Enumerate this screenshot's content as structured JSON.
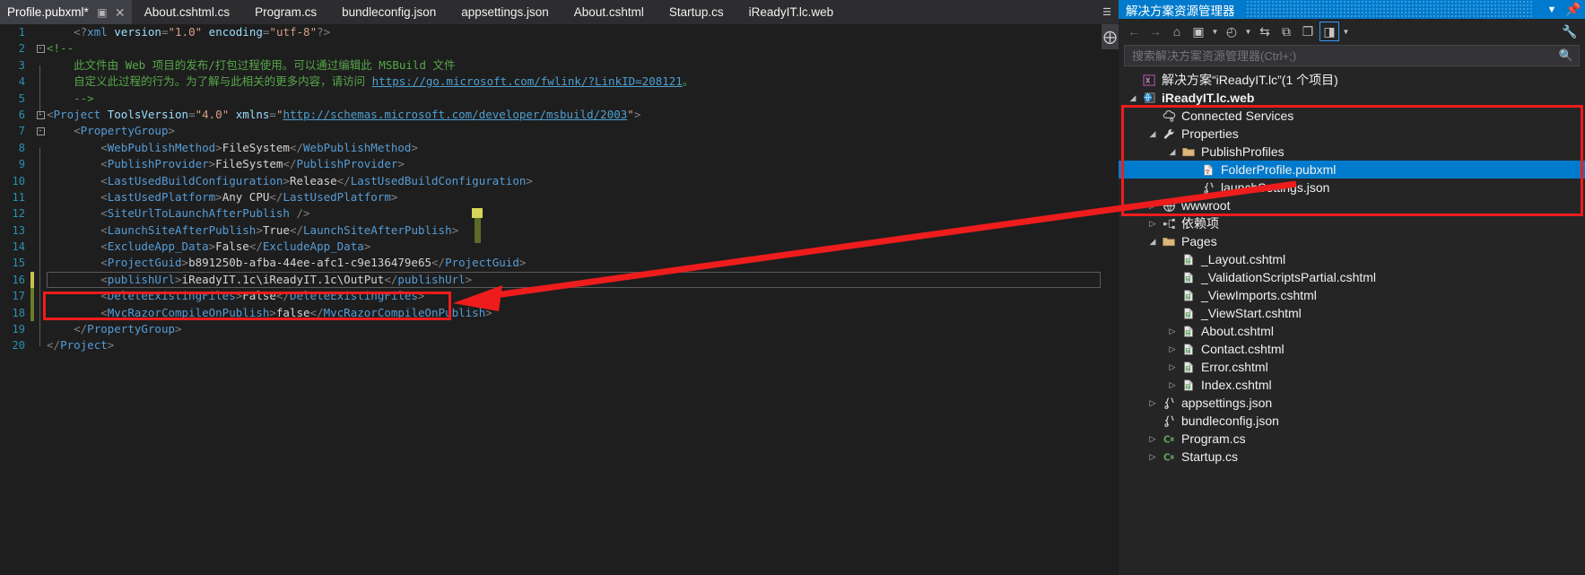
{
  "window": {
    "theme_background": "#1e1e1e",
    "accent": "#007acc",
    "highlight_rect_color": "#ee1c1c"
  },
  "tabs": {
    "items": [
      {
        "label": "Profile.pubxml*",
        "active": true,
        "pin_icon": "pin-icon",
        "close_icon": "close-icon"
      },
      {
        "label": "About.cshtml.cs",
        "active": false
      },
      {
        "label": "Program.cs",
        "active": false
      },
      {
        "label": "bundleconfig.json",
        "active": false
      },
      {
        "label": "appsettings.json",
        "active": false
      },
      {
        "label": "About.cshtml",
        "active": false
      },
      {
        "label": "Startup.cs",
        "active": false
      },
      {
        "label": "iReadyIT.lc.web",
        "active": false
      }
    ],
    "overflow_icon": "tab-overflow-icon"
  },
  "editor": {
    "language": "xml",
    "current_line": 16,
    "lines": [
      {
        "n": 1,
        "indent": 1,
        "tokens": [
          {
            "t": "punct",
            "s": "<?"
          },
          {
            "t": "tag",
            "s": "xml"
          },
          {
            "t": "plain",
            "s": " "
          },
          {
            "t": "attr",
            "s": "version"
          },
          {
            "t": "punct",
            "s": "="
          },
          {
            "t": "str",
            "s": "\"1.0\""
          },
          {
            "t": "plain",
            "s": " "
          },
          {
            "t": "attr",
            "s": "encoding"
          },
          {
            "t": "punct",
            "s": "="
          },
          {
            "t": "str",
            "s": "\"utf-8\""
          },
          {
            "t": "punct",
            "s": "?>"
          }
        ]
      },
      {
        "n": 2,
        "indent": 0,
        "fold": "collapse",
        "tokens": [
          {
            "t": "com",
            "s": "<!--"
          }
        ]
      },
      {
        "n": 3,
        "indent": 1,
        "bar": true,
        "tokens": [
          {
            "t": "com",
            "s": "此文件由 Web 项目的发布/打包过程使用。可以通过编辑此 MSBuild 文件"
          }
        ]
      },
      {
        "n": 4,
        "indent": 1,
        "bar": true,
        "tokens": [
          {
            "t": "com",
            "s": "自定义此过程的行为。为了解与此相关的更多内容，请访问 "
          },
          {
            "t": "link",
            "s": "https://go.microsoft.com/fwlink/?LinkID=208121"
          },
          {
            "t": "com",
            "s": "。"
          }
        ]
      },
      {
        "n": 5,
        "indent": 1,
        "bar": true,
        "tokens": [
          {
            "t": "com",
            "s": "-->"
          }
        ]
      },
      {
        "n": 6,
        "indent": 0,
        "fold": "collapse",
        "tokens": [
          {
            "t": "punct",
            "s": "<"
          },
          {
            "t": "tag",
            "s": "Project"
          },
          {
            "t": "plain",
            "s": " "
          },
          {
            "t": "attr",
            "s": "ToolsVersion"
          },
          {
            "t": "punct",
            "s": "="
          },
          {
            "t": "str",
            "s": "\"4.0\""
          },
          {
            "t": "plain",
            "s": " "
          },
          {
            "t": "attr",
            "s": "xmlns"
          },
          {
            "t": "punct",
            "s": "="
          },
          {
            "t": "str",
            "s": "\""
          },
          {
            "t": "link",
            "s": "http://schemas.microsoft.com/developer/msbuild/2003"
          },
          {
            "t": "str",
            "s": "\""
          },
          {
            "t": "punct",
            "s": ">"
          }
        ]
      },
      {
        "n": 7,
        "indent": 1,
        "fold": "collapse",
        "bar": true,
        "tokens": [
          {
            "t": "punct",
            "s": "<"
          },
          {
            "t": "tag",
            "s": "PropertyGroup"
          },
          {
            "t": "punct",
            "s": ">"
          }
        ]
      },
      {
        "n": 8,
        "indent": 2,
        "bar": true,
        "tokens": [
          {
            "t": "punct",
            "s": "<"
          },
          {
            "t": "tag",
            "s": "WebPublishMethod"
          },
          {
            "t": "punct",
            "s": ">"
          },
          {
            "t": "val",
            "s": "FileSystem"
          },
          {
            "t": "punct",
            "s": "</"
          },
          {
            "t": "tag",
            "s": "WebPublishMethod"
          },
          {
            "t": "punct",
            "s": ">"
          }
        ]
      },
      {
        "n": 9,
        "indent": 2,
        "bar": true,
        "tokens": [
          {
            "t": "punct",
            "s": "<"
          },
          {
            "t": "tag",
            "s": "PublishProvider"
          },
          {
            "t": "punct",
            "s": ">"
          },
          {
            "t": "val",
            "s": "FileSystem"
          },
          {
            "t": "punct",
            "s": "</"
          },
          {
            "t": "tag",
            "s": "PublishProvider"
          },
          {
            "t": "punct",
            "s": ">"
          }
        ]
      },
      {
        "n": 10,
        "indent": 2,
        "bar": true,
        "tokens": [
          {
            "t": "punct",
            "s": "<"
          },
          {
            "t": "tag",
            "s": "LastUsedBuildConfiguration"
          },
          {
            "t": "punct",
            "s": ">"
          },
          {
            "t": "val",
            "s": "Release"
          },
          {
            "t": "punct",
            "s": "</"
          },
          {
            "t": "tag",
            "s": "LastUsedBuildConfiguration"
          },
          {
            "t": "punct",
            "s": ">"
          }
        ]
      },
      {
        "n": 11,
        "indent": 2,
        "bar": true,
        "tokens": [
          {
            "t": "punct",
            "s": "<"
          },
          {
            "t": "tag",
            "s": "LastUsedPlatform"
          },
          {
            "t": "punct",
            "s": ">"
          },
          {
            "t": "val",
            "s": "Any CPU"
          },
          {
            "t": "punct",
            "s": "</"
          },
          {
            "t": "tag",
            "s": "LastUsedPlatform"
          },
          {
            "t": "punct",
            "s": ">"
          }
        ]
      },
      {
        "n": 12,
        "indent": 2,
        "bar": true,
        "tokens": [
          {
            "t": "punct",
            "s": "<"
          },
          {
            "t": "tag",
            "s": "SiteUrlToLaunchAfterPublish"
          },
          {
            "t": "plain",
            "s": " "
          },
          {
            "t": "punct",
            "s": "/>"
          }
        ]
      },
      {
        "n": 13,
        "indent": 2,
        "bar": true,
        "tokens": [
          {
            "t": "punct",
            "s": "<"
          },
          {
            "t": "tag",
            "s": "LaunchSiteAfterPublish"
          },
          {
            "t": "punct",
            "s": ">"
          },
          {
            "t": "val",
            "s": "True"
          },
          {
            "t": "punct",
            "s": "</"
          },
          {
            "t": "tag",
            "s": "LaunchSiteAfterPublish"
          },
          {
            "t": "punct",
            "s": ">"
          }
        ]
      },
      {
        "n": 14,
        "indent": 2,
        "bar": true,
        "tokens": [
          {
            "t": "punct",
            "s": "<"
          },
          {
            "t": "tag",
            "s": "ExcludeApp_Data"
          },
          {
            "t": "punct",
            "s": ">"
          },
          {
            "t": "val",
            "s": "False"
          },
          {
            "t": "punct",
            "s": "</"
          },
          {
            "t": "tag",
            "s": "ExcludeApp_Data"
          },
          {
            "t": "punct",
            "s": ">"
          }
        ]
      },
      {
        "n": 15,
        "indent": 2,
        "bar": true,
        "tokens": [
          {
            "t": "punct",
            "s": "<"
          },
          {
            "t": "tag",
            "s": "ProjectGuid"
          },
          {
            "t": "punct",
            "s": ">"
          },
          {
            "t": "val",
            "s": "b891250b-afba-44ee-afc1-c9e136479e65"
          },
          {
            "t": "punct",
            "s": "</"
          },
          {
            "t": "tag",
            "s": "ProjectGuid"
          },
          {
            "t": "punct",
            "s": ">"
          }
        ]
      },
      {
        "n": 16,
        "indent": 2,
        "bar": true,
        "change": "saved",
        "current": true,
        "tokens": [
          {
            "t": "punct",
            "s": "<"
          },
          {
            "t": "tag",
            "s": "publishUrl"
          },
          {
            "t": "punct",
            "s": ">"
          },
          {
            "t": "val",
            "s": "iReadyIT.1c\\iReadyIT.1c\\OutPut"
          },
          {
            "t": "punct",
            "s": "</"
          },
          {
            "t": "tag",
            "s": "publishUrl"
          },
          {
            "t": "punct",
            "s": ">"
          }
        ]
      },
      {
        "n": 17,
        "indent": 2,
        "bar": true,
        "change": "unsaved",
        "tokens": [
          {
            "t": "punct",
            "s": "<"
          },
          {
            "t": "tag",
            "s": "DeleteExistingFiles"
          },
          {
            "t": "punct",
            "s": ">"
          },
          {
            "t": "val",
            "s": "False"
          },
          {
            "t": "punct",
            "s": "</"
          },
          {
            "t": "tag",
            "s": "DeleteExistingFiles"
          },
          {
            "t": "punct",
            "s": ">"
          }
        ]
      },
      {
        "n": 18,
        "indent": 2,
        "bar": true,
        "change": "unsaved",
        "tokens": [
          {
            "t": "punct",
            "s": "<"
          },
          {
            "t": "tag",
            "s": "MvcRazorCompileOnPublish"
          },
          {
            "t": "punct",
            "s": ">"
          },
          {
            "t": "val",
            "s": "false"
          },
          {
            "t": "punct",
            "s": "</"
          },
          {
            "t": "tag",
            "s": "MvcRazorCompileOnPublish"
          },
          {
            "t": "punct",
            "s": ">"
          }
        ]
      },
      {
        "n": 19,
        "indent": 1,
        "bar": true,
        "tokens": [
          {
            "t": "punct",
            "s": "</"
          },
          {
            "t": "tag",
            "s": "PropertyGroup"
          },
          {
            "t": "punct",
            "s": ">"
          }
        ]
      },
      {
        "n": 20,
        "indent": 0,
        "tokens": [
          {
            "t": "punct",
            "s": "</"
          },
          {
            "t": "tag",
            "s": "Project"
          },
          {
            "t": "punct",
            "s": ">"
          }
        ]
      }
    ]
  },
  "solution_explorer": {
    "title": "解决方案资源管理器",
    "title_dropdown_icon": "chevron-down-icon",
    "title_pin_icon": "pin-icon",
    "toolbar": [
      {
        "name": "back-button",
        "glyph": "←",
        "dim": true
      },
      {
        "name": "forward-button",
        "glyph": "→",
        "dim": true
      },
      {
        "name": "home-button",
        "glyph": "⌂"
      },
      {
        "name": "switch-views-button",
        "glyph": "▣"
      },
      {
        "name": "switch-views-caret",
        "caret": true
      },
      {
        "name": "pending-changes-button",
        "glyph": "◴"
      },
      {
        "name": "pending-changes-caret",
        "caret": true
      },
      {
        "name": "sync-with-active-document-button",
        "glyph": "⇆"
      },
      {
        "name": "refresh-button",
        "glyph": "⧉"
      },
      {
        "name": "collapse-all-button",
        "glyph": "❐"
      },
      {
        "name": "show-all-files-button",
        "glyph": "◨",
        "boxed": true
      },
      {
        "name": "show-all-files-caret",
        "caret": true
      },
      {
        "name": "properties-button",
        "glyph": "🔧"
      }
    ],
    "search": {
      "placeholder": "搜索解决方案资源管理器(Ctrl+;)",
      "value": "",
      "icon": "search-icon"
    },
    "tree": [
      {
        "depth": 0,
        "twisty": "",
        "icon": "solution-icon",
        "label": "解决方案“iReadyIT.lc”(1 个项目)",
        "bold": false
      },
      {
        "depth": 0,
        "twisty": "◢",
        "icon": "web-project-icon",
        "label": "iReadyIT.lc.web",
        "bold": true
      },
      {
        "depth": 1,
        "twisty": "",
        "icon": "connected-services-icon",
        "label": "Connected Services"
      },
      {
        "depth": 1,
        "twisty": "◢",
        "icon": "wrench-icon",
        "label": "Properties"
      },
      {
        "depth": 2,
        "twisty": "◢",
        "icon": "folder-icon",
        "label": "PublishProfiles"
      },
      {
        "depth": 3,
        "twisty": "",
        "icon": "pubxml-file-icon",
        "label": "FolderProfile.pubxml",
        "selected": true
      },
      {
        "depth": 3,
        "twisty": "",
        "icon": "json-file-icon",
        "label": "launchSettings.json"
      },
      {
        "depth": 1,
        "twisty": "▷",
        "icon": "globe-icon",
        "label": "wwwroot"
      },
      {
        "depth": 1,
        "twisty": "▷",
        "icon": "dependencies-icon",
        "label": "依赖项"
      },
      {
        "depth": 1,
        "twisty": "◢",
        "icon": "folder-icon",
        "label": "Pages"
      },
      {
        "depth": 2,
        "twisty": "",
        "icon": "cshtml-file-icon",
        "label": "_Layout.cshtml"
      },
      {
        "depth": 2,
        "twisty": "",
        "icon": "cshtml-file-icon",
        "label": "_ValidationScriptsPartial.cshtml"
      },
      {
        "depth": 2,
        "twisty": "",
        "icon": "cshtml-file-icon",
        "label": "_ViewImports.cshtml"
      },
      {
        "depth": 2,
        "twisty": "",
        "icon": "cshtml-file-icon",
        "label": "_ViewStart.cshtml"
      },
      {
        "depth": 2,
        "twisty": "▷",
        "icon": "cshtml-file-icon",
        "label": "About.cshtml"
      },
      {
        "depth": 2,
        "twisty": "▷",
        "icon": "cshtml-file-icon",
        "label": "Contact.cshtml"
      },
      {
        "depth": 2,
        "twisty": "▷",
        "icon": "cshtml-file-icon",
        "label": "Error.cshtml"
      },
      {
        "depth": 2,
        "twisty": "▷",
        "icon": "cshtml-file-icon",
        "label": "Index.cshtml"
      },
      {
        "depth": 1,
        "twisty": "▷",
        "icon": "json-file-icon",
        "label": "appsettings.json"
      },
      {
        "depth": 1,
        "twisty": "",
        "icon": "json-file-icon",
        "label": "bundleconfig.json"
      },
      {
        "depth": 1,
        "twisty": "▷",
        "icon": "csharp-file-icon",
        "label": "Program.cs"
      },
      {
        "depth": 1,
        "twisty": "▷",
        "icon": "csharp-file-icon",
        "label": "Startup.cs"
      }
    ]
  },
  "annotations": {
    "arrow_color": "#ee1c1c",
    "code_rect_label": "MvcRazorCompileOnPublish line highlight",
    "tree_rect_label": "PublishProfiles subtree highlight"
  }
}
